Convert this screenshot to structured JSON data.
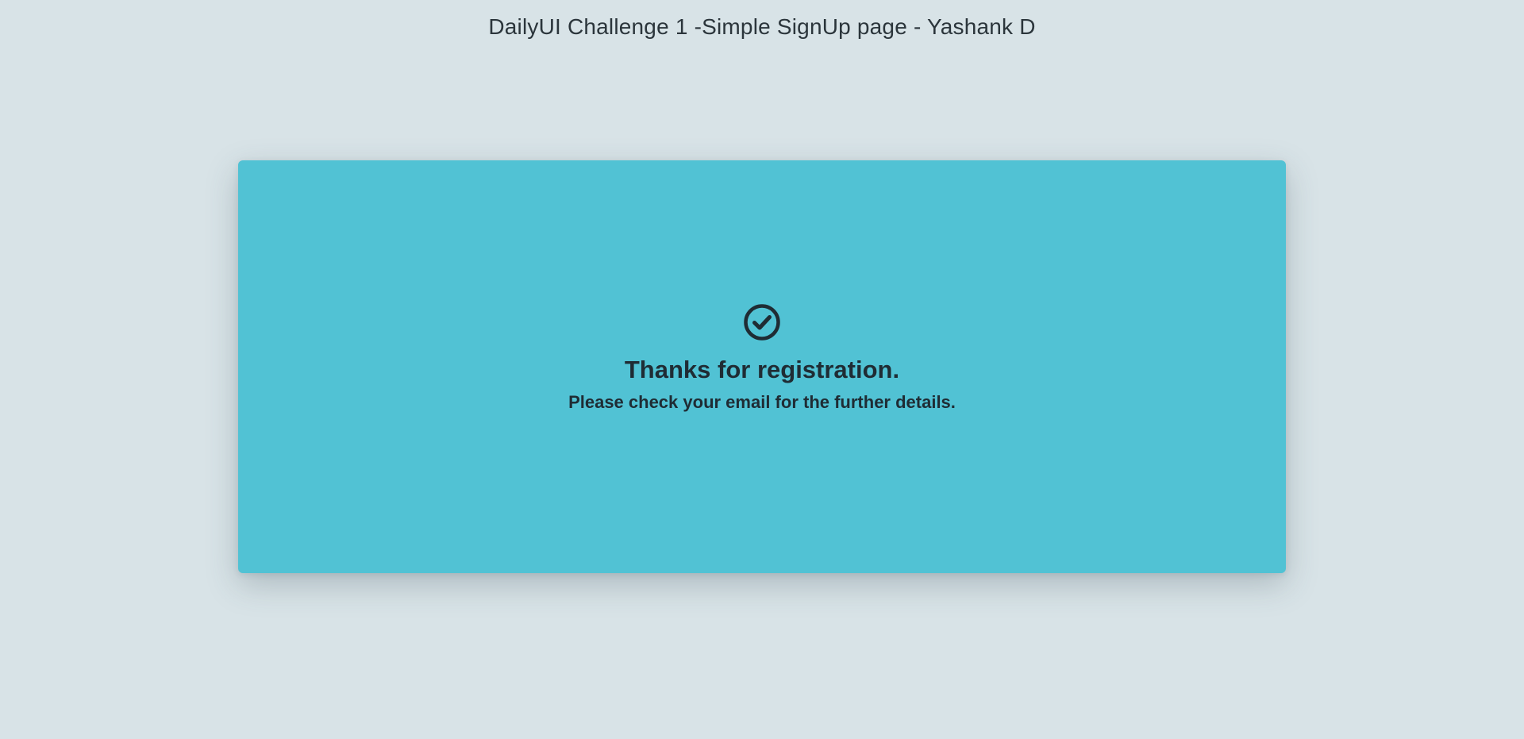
{
  "header": {
    "title": "DailyUI Challenge 1 -Simple SignUp page - Yashank D"
  },
  "card": {
    "icon": "check-circle-icon",
    "heading": "Thanks for registration.",
    "message": "Please check your email for the further details."
  },
  "colors": {
    "background": "#d8e3e7",
    "card": "#51c2d4",
    "text": "#1f2c34"
  }
}
